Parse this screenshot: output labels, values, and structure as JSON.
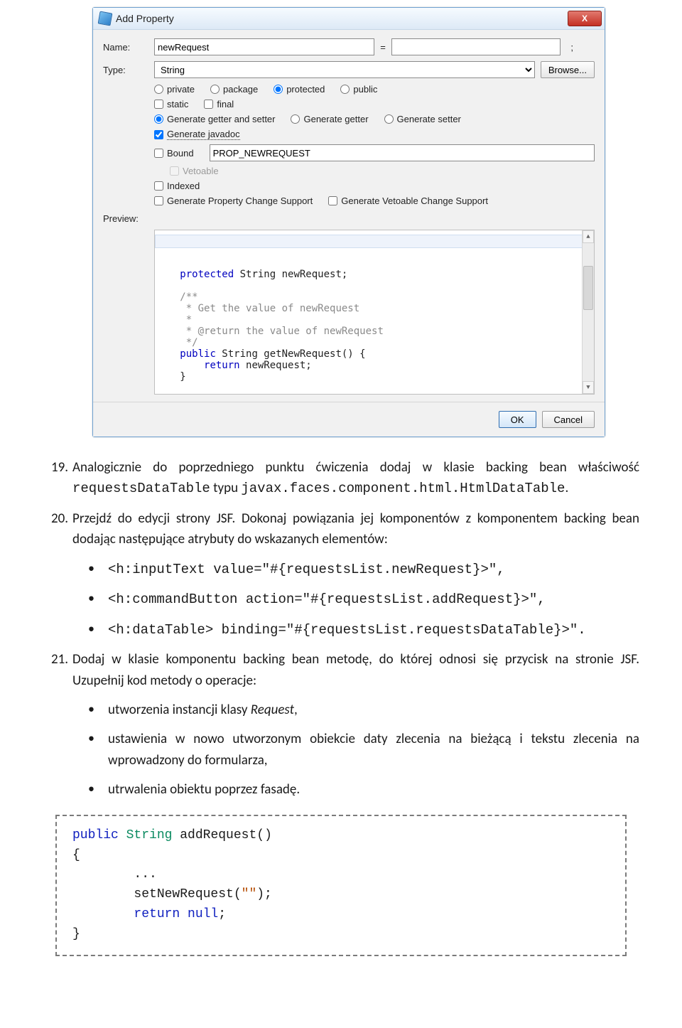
{
  "dialog": {
    "title": "Add Property",
    "close_glyph": "X",
    "name_label": "Name:",
    "name_value": "newRequest",
    "equals": "=",
    "value_value": "",
    "semicolon": ";",
    "type_label": "Type:",
    "type_value": "String",
    "browse_label": "Browse...",
    "access": {
      "private": "private",
      "package": "package",
      "protected": "protected",
      "public": "public"
    },
    "flags": {
      "static": "static",
      "final": "final"
    },
    "gen": {
      "both": "Generate getter and setter",
      "getter": "Generate getter",
      "setter": "Generate setter"
    },
    "javadoc": "Generate javadoc",
    "bound_label": "Bound",
    "bound_value": "PROP_NEWREQUEST",
    "vetoable": "Vetoable",
    "indexed": "Indexed",
    "pcs": "Generate Property Change Support",
    "vcs": "Generate Vetoable Change Support",
    "preview_label": "Preview:",
    "preview_code": {
      "l1a": "protected",
      "l1b": " String newRequest;",
      "l3": "/**",
      "l4": " * Get the value of newRequest",
      "l5": " *",
      "l6": " * @return the value of newRequest",
      "l7": " */",
      "l8a": "public",
      "l8b": " String getNewRequest() {",
      "l9a": "    return",
      "l9b": " newRequest;",
      "l10": "}"
    },
    "ok": "OK",
    "cancel": "Cancel"
  },
  "body": {
    "p19_num": "19.",
    "p19_a": "Analogicznie do poprzedniego punktu ćwiczenia dodaj w klasie backing bean właściwość ",
    "p19_code1": "requestsDataTable",
    "p19_b": " typu ",
    "p19_code2": "javax.faces.component.html.HtmlDataTable",
    "p19_c": ".",
    "p20_num": "20.",
    "p20_a": "Przejdź do edycji strony JSF. Dokonaj powiązania jej komponentów z komponentem backing bean dodając następujące atrybuty do wskazanych elementów:",
    "b1": "<h:inputText value=\"#{requestsList.newRequest}>\",",
    "b2": "<h:commandButton action=\"#{requestsList.addRequest}>\",",
    "b3": "<h:dataTable> binding=\"#{requestsList.requestsDataTable}>\".",
    "p21_num": "21.",
    "p21_a": "Dodaj w klasie komponentu backing bean metodę, do której odnosi się przycisk na stronie JSF. Uzupełnij kod metody o operacje:",
    "c1_a": "utworzenia instancji klasy ",
    "c1_b": "Request",
    "c1_c": ",",
    "c2": "ustawienia w nowo utworzonym obiekcie daty zlecenia na bieżącą i tekstu zlecenia na wprowadzony do formularza,",
    "c3": "utrwalenia obiektu poprzez fasadę."
  },
  "code": {
    "l1a": "public ",
    "l1b": "String ",
    "l1c": "addRequest()",
    "l2": "{",
    "l3": "        ...",
    "l4a": "        setNewRequest(",
    "l4b": "\"\"",
    "l4c": ");",
    "l5a": "        return ",
    "l5b": "null",
    "l5c": ";",
    "l6": "}"
  }
}
